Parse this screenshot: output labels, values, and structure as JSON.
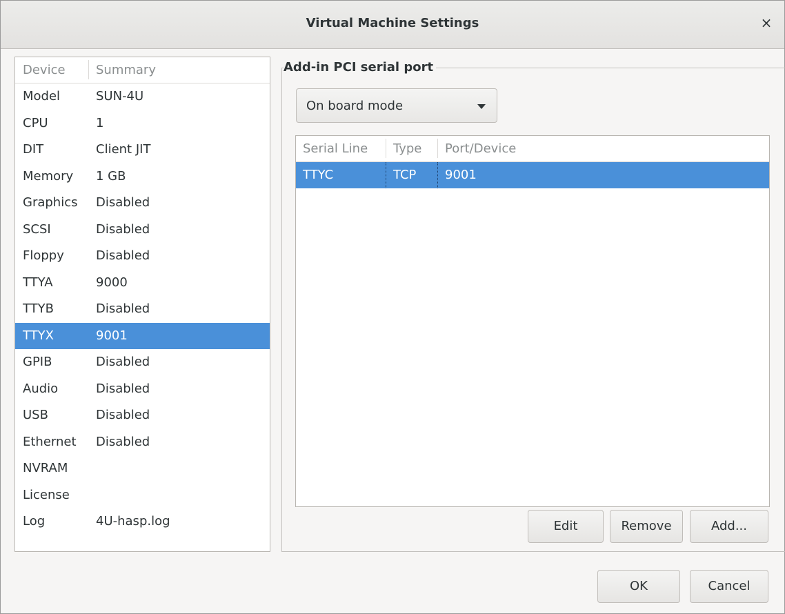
{
  "window": {
    "title": "Virtual Machine Settings",
    "close_icon": "×"
  },
  "device_list": {
    "headers": {
      "device": "Device",
      "summary": "Summary"
    },
    "rows": [
      {
        "device": "Model",
        "summary": "SUN-4U"
      },
      {
        "device": "CPU",
        "summary": "1"
      },
      {
        "device": "DIT",
        "summary": "Client JIT"
      },
      {
        "device": "Memory",
        "summary": "1 GB"
      },
      {
        "device": "Graphics",
        "summary": "Disabled"
      },
      {
        "device": "SCSI",
        "summary": "Disabled"
      },
      {
        "device": "Floppy",
        "summary": "Disabled"
      },
      {
        "device": "TTYA",
        "summary": "9000"
      },
      {
        "device": "TTYB",
        "summary": "Disabled"
      },
      {
        "device": "TTYX",
        "summary": "9001"
      },
      {
        "device": "GPIB",
        "summary": "Disabled"
      },
      {
        "device": "Audio",
        "summary": "Disabled"
      },
      {
        "device": "USB",
        "summary": "Disabled"
      },
      {
        "device": "Ethernet",
        "summary": "Disabled"
      },
      {
        "device": "NVRAM",
        "summary": ""
      },
      {
        "device": "License",
        "summary": ""
      },
      {
        "device": "Log",
        "summary": "4U-hasp.log"
      }
    ],
    "selected_index": 9
  },
  "panel": {
    "group_label": "Add-in PCI serial port",
    "mode_select": {
      "value": "On board mode"
    },
    "serial_table": {
      "headers": {
        "serial_line": "Serial Line",
        "type": "Type",
        "port": "Port/Device"
      },
      "rows": [
        {
          "serial_line": "TTYC",
          "type": "TCP",
          "port": "9001"
        }
      ]
    },
    "buttons": {
      "edit": "Edit",
      "remove": "Remove",
      "add": "Add..."
    }
  },
  "footer": {
    "ok": "OK",
    "cancel": "Cancel"
  },
  "colors": {
    "selection": "#4a90d9",
    "window_bg": "#f6f5f4"
  }
}
